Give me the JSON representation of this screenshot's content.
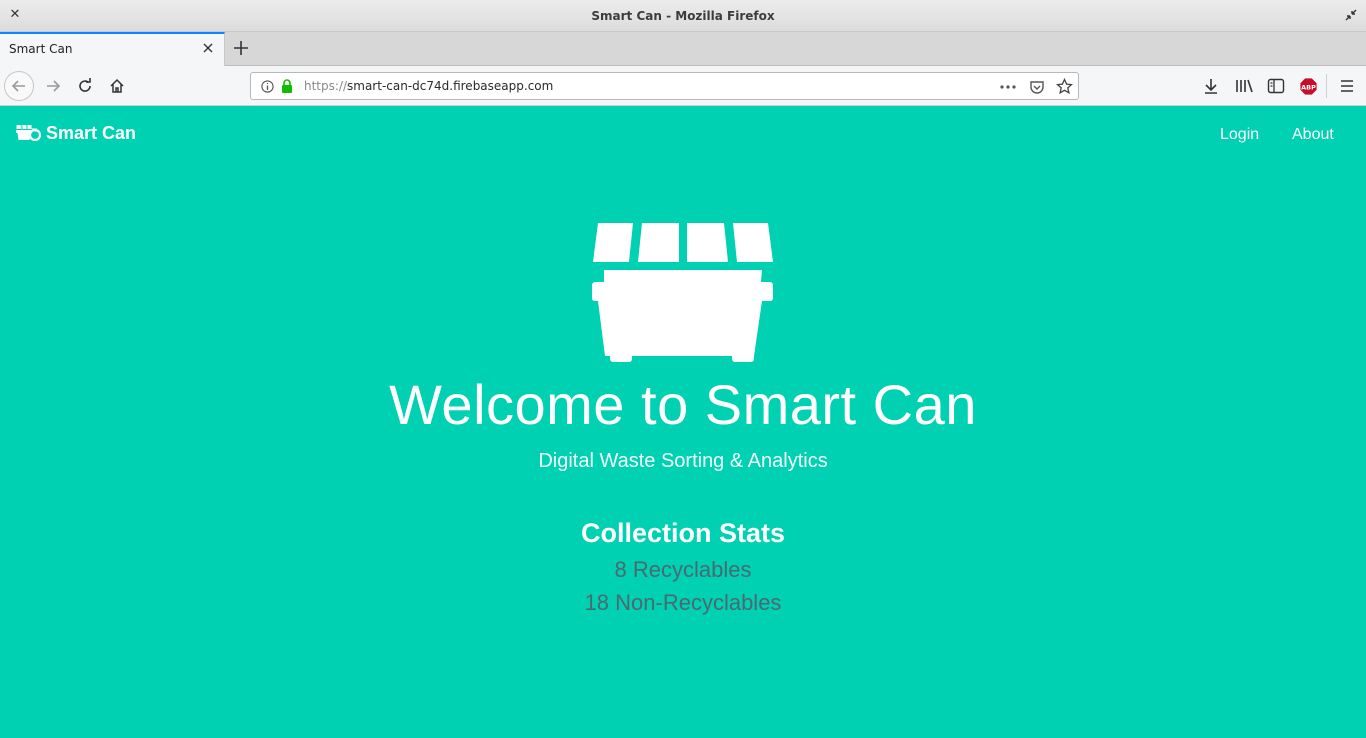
{
  "window": {
    "title": "Smart Can - Mozilla Firefox"
  },
  "tabs": [
    {
      "label": "Smart Can",
      "active": true
    }
  ],
  "urlbar": {
    "scheme": "https://",
    "host": "smart-can-dc74d.firebaseapp.com"
  },
  "toolbar": {
    "abp_label": "ABP"
  },
  "site": {
    "brand": "Smart Can",
    "nav": {
      "login": "Login",
      "about": "About"
    },
    "hero": {
      "title": "Welcome to Smart Can",
      "subtitle": "Digital Waste Sorting & Analytics"
    },
    "stats": {
      "title": "Collection Stats",
      "recyclables": "8 Recyclables",
      "non_recyclables": "18 Non-Recyclables"
    }
  },
  "colors": {
    "page_bg": "#00d1b2",
    "stat_text": "#4a6a73",
    "accent": "#0a84ff"
  },
  "icons": [
    "close-icon",
    "restore-icon",
    "back-icon",
    "forward-icon",
    "reload-icon",
    "home-icon",
    "info-icon",
    "lock-icon",
    "more-icon",
    "pocket-icon",
    "star-icon",
    "download-icon",
    "library-icon",
    "sidebar-icon",
    "abp-icon",
    "menu-icon",
    "dumpster-icon"
  ]
}
